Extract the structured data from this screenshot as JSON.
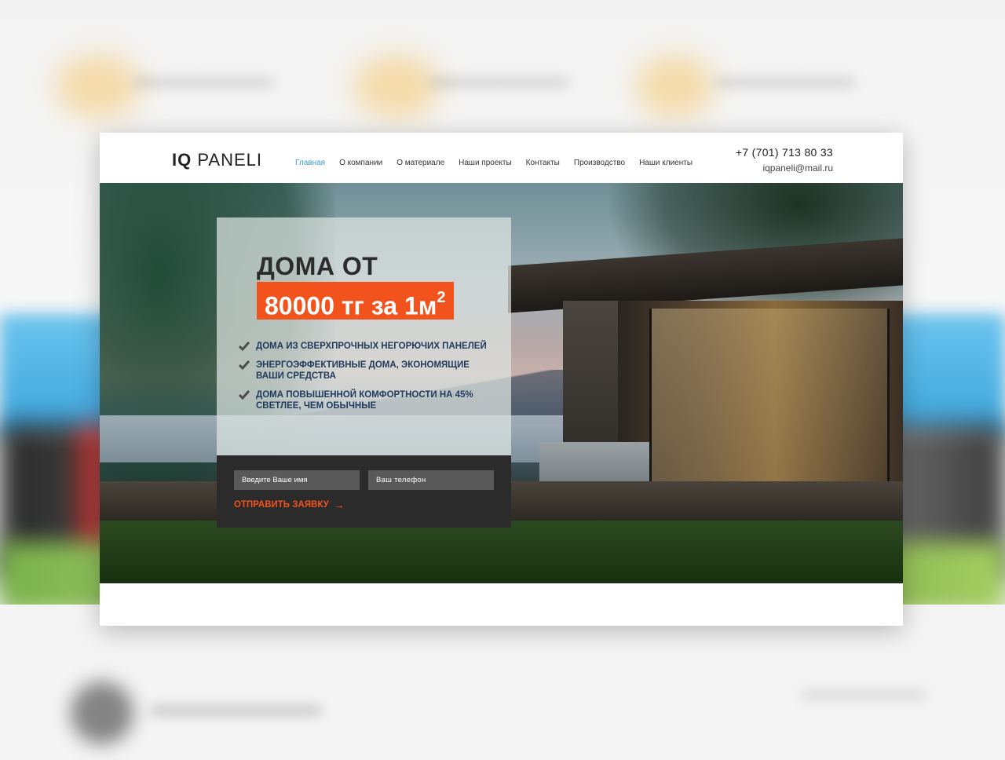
{
  "logo": {
    "part1": "IQ",
    "part2": "PANELI"
  },
  "nav": {
    "items": [
      {
        "label": "Главная",
        "active": true
      },
      {
        "label": "О компании",
        "active": false
      },
      {
        "label": "О материале",
        "active": false
      },
      {
        "label": "Наши проекты",
        "active": false
      },
      {
        "label": "Контакты",
        "active": false
      },
      {
        "label": "Производство",
        "active": false
      },
      {
        "label": "Наши клиенты",
        "active": false
      }
    ]
  },
  "contacts": {
    "phone": "+7 (701) 713 80 33",
    "email": "iqpaneli@mail.ru"
  },
  "hero": {
    "headline": "ДОМА ОТ",
    "price": "80000 тг за 1м",
    "price_sup": "2",
    "features": [
      "ДОМА ИЗ СВЕРХПРОЧНЫХ НЕГОРЮЧИХ ПАНЕЛЕЙ",
      "ЭНЕРГОЭФФЕКТИВНЫЕ ДОМА, ЭКОНОМЯЩИЕ ВАШИ СРЕДСТВА",
      "ДОМА ПОВЫШЕННОЙ КОМФОРТНОСТИ НА 45% СВЕТЛЕЕ, ЧЕМ ОБЫЧНЫЕ"
    ]
  },
  "form": {
    "name_placeholder": "Введите Ваше имя",
    "phone_placeholder": "Ваш телефон",
    "submit_label": "ОТПРАВИТЬ ЗАЯВКУ"
  },
  "colors": {
    "accent": "#f2531c",
    "nav_active": "#3aa0d8",
    "form_bg": "#2b2b2b",
    "feature_text": "#1f3a5a"
  }
}
